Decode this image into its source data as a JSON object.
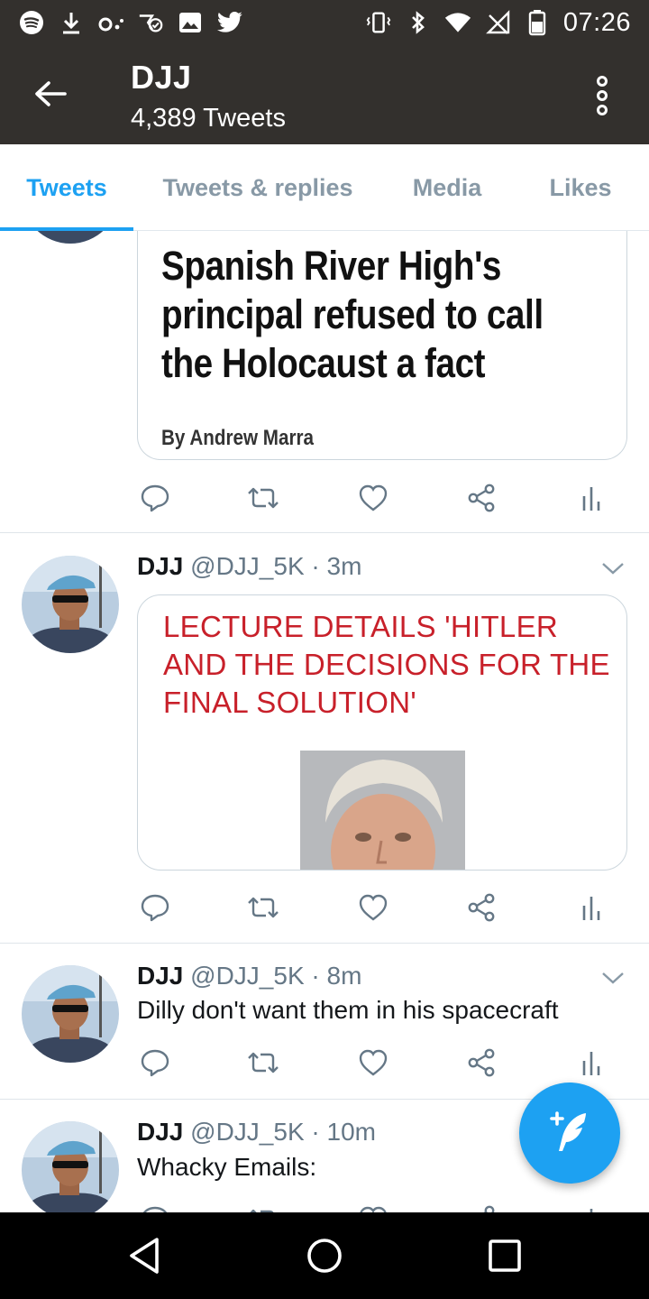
{
  "status_bar": {
    "time": "07:26",
    "left_icons": [
      "spotify-icon",
      "download-icon",
      "voicemail-icon",
      "tweet-check-icon",
      "image-icon",
      "twitter-icon"
    ],
    "right_icons": [
      "vibrate-icon",
      "bluetooth-icon",
      "wifi-icon",
      "signal-icon",
      "battery-icon"
    ]
  },
  "header": {
    "title": "DJJ",
    "subtitle": "4,389 Tweets",
    "back_icon": "arrow-left-icon",
    "overflow_icon": "more-vertical-icon"
  },
  "tabs": [
    {
      "label": "Tweets",
      "active": true
    },
    {
      "label": "Tweets & replies",
      "active": false
    },
    {
      "label": "Media",
      "active": false
    },
    {
      "label": "Likes",
      "active": false
    }
  ],
  "tweets": [
    {
      "card_headline": "Spanish River High's principal refused to call the Holocaust a fact",
      "card_byline": "By Andrew Marra"
    },
    {
      "name": "DJJ",
      "handle": "@DJJ_5K",
      "time": "· 3m",
      "card_headline": "LECTURE DETAILS 'HITLER AND THE DECISIONS FOR THE FINAL SOLUTION'"
    },
    {
      "name": "DJJ",
      "handle": "@DJJ_5K",
      "time": "· 8m",
      "text": "Dilly don't want them in his spacecraft"
    },
    {
      "name": "DJJ",
      "handle": "@DJJ_5K",
      "time": "· 10m",
      "text": "Whacky Emails:"
    }
  ],
  "action_icons": [
    "reply-icon",
    "retweet-icon",
    "like-icon",
    "share-icon",
    "analytics-icon"
  ],
  "colors": {
    "accent": "#1da1f2",
    "header_bg": "#33302d",
    "headline_red": "#c8202a",
    "muted": "#657786"
  },
  "fab": {
    "icon": "compose-tweet-icon"
  },
  "nav_bar": {
    "icons": [
      "back-triangle-icon",
      "home-circle-icon",
      "recents-square-icon"
    ]
  }
}
